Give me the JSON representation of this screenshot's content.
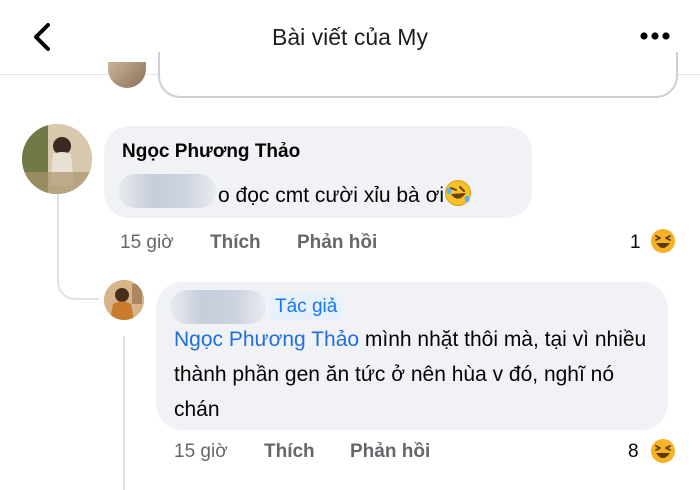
{
  "header": {
    "title": "Bài viết của My",
    "back_icon": "chevron-left-icon",
    "more_icon": "more-dots-icon"
  },
  "comment": {
    "author": "Ngọc Phương Thảo",
    "text_visible": "o đọc cmt cười xỉu bà ơi",
    "emoji": "rolling-laughing-emoji",
    "time": "15 giờ",
    "like_label": "Thích",
    "reply_label": "Phản hồi",
    "reaction_count": "1",
    "reaction_icon": "laughing-reaction-icon"
  },
  "reply": {
    "author_badge": "Tác giả",
    "mention": "Ngọc Phương Thảo",
    "text": " mình nhặt thôi mà, tại vì nhiều thành phần gen ăn tức ở nên hùa v đó, nghĩ nó chán",
    "time": "15 giờ",
    "like_label": "Thích",
    "reply_label": "Phản hồi",
    "reaction_count": "8",
    "reaction_icon": "laughing-reaction-icon"
  },
  "colors": {
    "bubble": "#f0f2f5",
    "link": "#216fdb",
    "meta": "#65676b",
    "reaction": "#f7b125"
  }
}
